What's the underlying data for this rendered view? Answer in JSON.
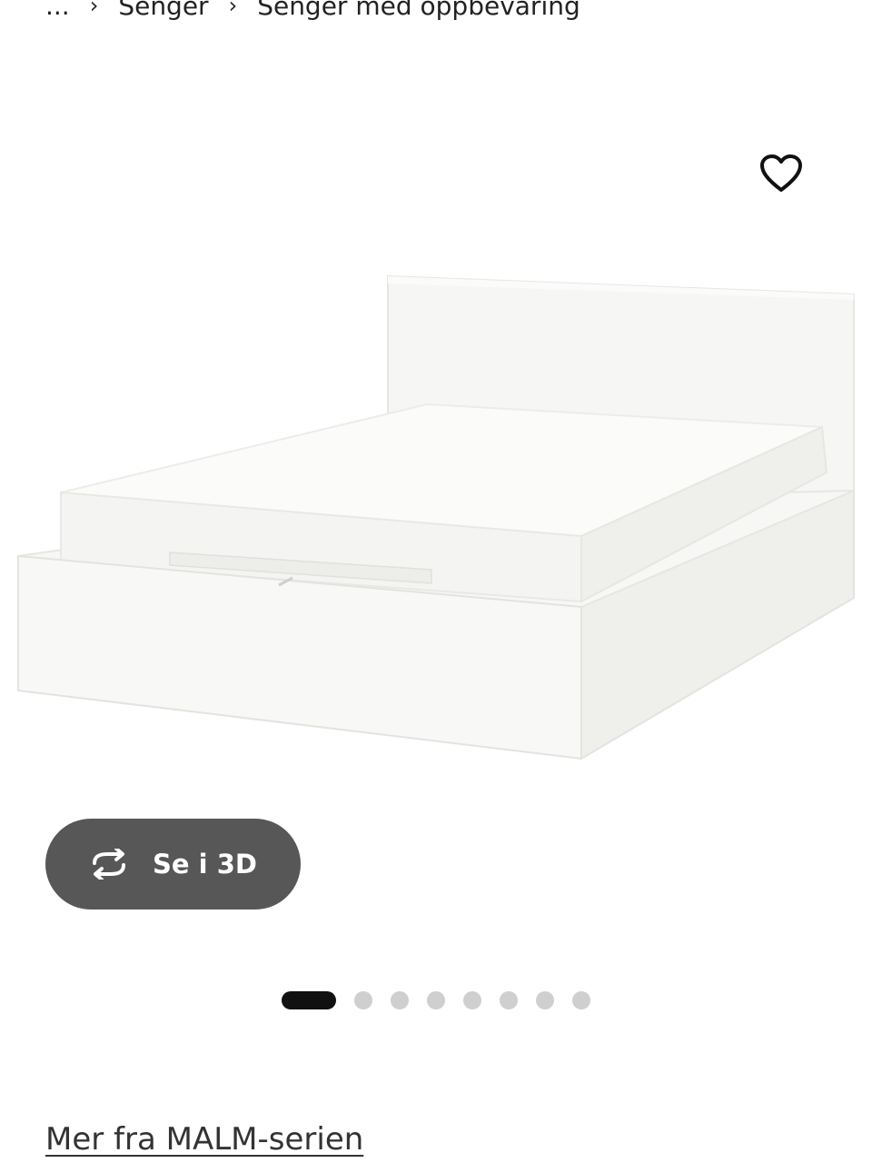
{
  "breadcrumb": {
    "items": [
      {
        "label": "..."
      },
      {
        "label": "Senger"
      },
      {
        "label": "Senger med oppbevaring"
      }
    ],
    "separator": "›"
  },
  "favorite": {
    "icon": "heart-outline-icon"
  },
  "product": {
    "image_icon": "bed-image"
  },
  "view3d": {
    "label": "Se i 3D",
    "icon": "rotate-arrows-icon"
  },
  "carousel": {
    "total": 8,
    "active": 1
  },
  "series_link": {
    "label": "Mer fra MALM-serien"
  }
}
